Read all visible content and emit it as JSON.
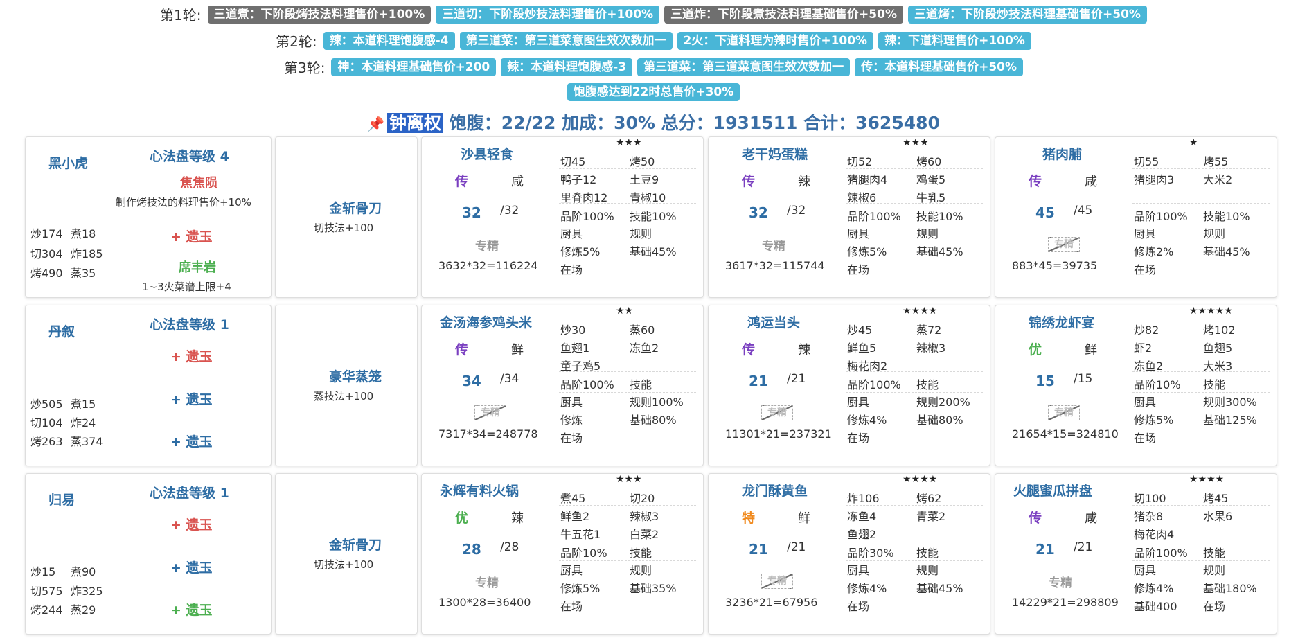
{
  "rounds": [
    {
      "label": "第1轮:",
      "tags": [
        {
          "text": "三道煮：下阶段烤技法料理售价+100%",
          "style": "gray"
        },
        {
          "text": "三道切：下阶段炒技法料理售价+100%",
          "style": "blue"
        },
        {
          "text": "三道炸：下阶段煮技法料理基础售价+50%",
          "style": "gray"
        },
        {
          "text": "三道烤：下阶段炒技法料理基础售价+50%",
          "style": "blue"
        }
      ]
    },
    {
      "label": "第2轮:",
      "tags": [
        {
          "text": "辣：本道料理饱腹感-4",
          "style": "blue"
        },
        {
          "text": "第三道菜：第三道菜意图生效次数加一",
          "style": "blue"
        },
        {
          "text": "2火：下道料理为辣时售价+100%",
          "style": "blue"
        },
        {
          "text": "辣：下道料理售价+100%",
          "style": "blue"
        }
      ]
    },
    {
      "label": "第3轮:",
      "tags": [
        {
          "text": "神：本道料理基础售价+200",
          "style": "blue"
        },
        {
          "text": "辣：本道料理饱腹感-3",
          "style": "blue"
        },
        {
          "text": "第三道菜：第三道菜意图生效次数加一",
          "style": "blue"
        },
        {
          "text": "传：本道料理基础售价+50%",
          "style": "blue"
        }
      ]
    },
    {
      "label": "",
      "tags": [
        {
          "text": "饱腹感达到22时总售价+30%",
          "style": "blue"
        }
      ]
    }
  ],
  "summary": {
    "pin_icon": "pin-icon",
    "chef": "钟离权",
    "text": "饱腹：22/22 加成：30% 总分：1931511 合计：3625480"
  },
  "rows": [
    {
      "chef": {
        "name": "黑小虎",
        "disk": "心法盘等级 4",
        "skill_name": "焦焦陨",
        "skill_desc": "制作烤技法的料理售价+10%",
        "slot1": "+ 遗玉",
        "slot2_name": "席丰岩",
        "slot2_desc": "1~3火菜谱上限+4",
        "stats": [
          [
            "炒174",
            "煮18"
          ],
          [
            "切304",
            "炸185"
          ],
          [
            "烤490",
            "蒸35"
          ]
        ]
      },
      "equip": {
        "name": "金斩骨刀",
        "desc": "切技法+100"
      },
      "dishes": [
        {
          "name": "沙县轻食",
          "stars": "★★★",
          "grade": "传",
          "grade_color": "purple",
          "taste": "咸",
          "qty": "32",
          "max": "/32",
          "skill": "专精",
          "skill_active": true,
          "formula": "3632*32=116224",
          "s1": [
            "切45",
            "烤50"
          ],
          "ing": [
            [
              "鸭子12",
              "土豆9"
            ],
            [
              "里脊肉12",
              "青椒10"
            ]
          ],
          "q": [
            "品阶100%",
            "技能10%"
          ],
          "t": [
            "厨具",
            "规则"
          ],
          "u": [
            "修炼5%",
            "基础45%"
          ],
          "v": [
            "在场",
            ""
          ]
        },
        {
          "name": "老干妈蛋糕",
          "stars": "★★★",
          "grade": "传",
          "grade_color": "purple",
          "taste": "辣",
          "qty": "32",
          "max": "/32",
          "skill": "专精",
          "skill_active": true,
          "formula": "3617*32=115744",
          "s1": [
            "切52",
            "烤60"
          ],
          "ing": [
            [
              "猪腿肉4",
              "鸡蛋5"
            ],
            [
              "辣椒6",
              "牛乳5"
            ]
          ],
          "q": [
            "品阶100%",
            "技能10%"
          ],
          "t": [
            "厨具",
            "规则"
          ],
          "u": [
            "修炼5%",
            "基础45%"
          ],
          "v": [
            "在场",
            ""
          ]
        },
        {
          "name": "猪肉脯",
          "stars": "★",
          "grade": "传",
          "grade_color": "purple",
          "taste": "咸",
          "qty": "45",
          "max": "/45",
          "skill": "专精",
          "skill_active": false,
          "formula": "883*45=39735",
          "s1": [
            "切55",
            "烤55"
          ],
          "ing": [
            [
              "猪腿肉3",
              "大米2"
            ],
            [
              "",
              ""
            ]
          ],
          "q": [
            "品阶100%",
            "技能10%"
          ],
          "t": [
            "厨具",
            "规则"
          ],
          "u": [
            "修炼2%",
            "基础45%"
          ],
          "v": [
            "在场",
            ""
          ]
        }
      ]
    },
    {
      "chef": {
        "name": "丹叙",
        "disk": "心法盘等级 1",
        "skill_name": "",
        "skill_desc": "",
        "slot1": "+ 遗玉",
        "slot2": "+ 遗玉",
        "slot3": "+ 遗玉",
        "stats": [
          [
            "炒505",
            "煮15"
          ],
          [
            "切104",
            "炸24"
          ],
          [
            "烤263",
            "蒸374"
          ]
        ]
      },
      "equip": {
        "name": "豪华蒸笼",
        "desc": "蒸技法+100"
      },
      "dishes": [
        {
          "name": "金汤海参鸡头米",
          "stars": "★★",
          "grade": "传",
          "grade_color": "purple",
          "taste": "鲜",
          "qty": "34",
          "max": "/34",
          "skill": "专精",
          "skill_active": false,
          "formula": "7317*34=248778",
          "s1": [
            "炒30",
            "蒸60"
          ],
          "ing": [
            [
              "鱼翅1",
              "冻鱼2"
            ],
            [
              "童子鸡5",
              ""
            ]
          ],
          "q": [
            "品阶100%",
            "技能"
          ],
          "t": [
            "厨具",
            "规则100%"
          ],
          "u": [
            "修炼",
            "基础80%"
          ],
          "v": [
            "在场",
            ""
          ]
        },
        {
          "name": "鸿运当头",
          "stars": "★★★★",
          "grade": "传",
          "grade_color": "purple",
          "taste": "辣",
          "qty": "21",
          "max": "/21",
          "skill": "专精",
          "skill_active": false,
          "formula": "11301*21=237321",
          "s1": [
            "炒45",
            "蒸72"
          ],
          "ing": [
            [
              "鲜鱼5",
              "辣椒3"
            ],
            [
              "梅花肉2",
              ""
            ]
          ],
          "q": [
            "品阶100%",
            "技能"
          ],
          "t": [
            "厨具",
            "规则200%"
          ],
          "u": [
            "修炼4%",
            "基础80%"
          ],
          "v": [
            "在场",
            ""
          ]
        },
        {
          "name": "锦绣龙虾宴",
          "stars": "★★★★★",
          "grade": "优",
          "grade_color": "green",
          "taste": "鲜",
          "qty": "15",
          "max": "/15",
          "skill": "专精",
          "skill_active": false,
          "formula": "21654*15=324810",
          "s1": [
            "炒82",
            "烤102"
          ],
          "ing": [
            [
              "虾2",
              "鱼翅5"
            ],
            [
              "冻鱼2",
              "大米3"
            ]
          ],
          "q": [
            "品阶10%",
            "技能"
          ],
          "t": [
            "厨具",
            "规则300%"
          ],
          "u": [
            "修炼5%",
            "基础125%"
          ],
          "v": [
            "在场",
            ""
          ]
        }
      ]
    },
    {
      "chef": {
        "name": "归易",
        "disk": "心法盘等级 1",
        "skill_name": "",
        "skill_desc": "",
        "slot1": "+ 遗玉",
        "slot2": "+ 遗玉",
        "slot3": "+ 遗玉",
        "stats": [
          [
            "炒15",
            "煮90"
          ],
          [
            "切575",
            "炸325"
          ],
          [
            "烤244",
            "蒸29"
          ]
        ]
      },
      "equip": {
        "name": "金斩骨刀",
        "desc": "切技法+100"
      },
      "dishes": [
        {
          "name": "永辉有料火锅",
          "stars": "★★★",
          "grade": "优",
          "grade_color": "green",
          "taste": "辣",
          "qty": "28",
          "max": "/28",
          "skill": "专精",
          "skill_active": true,
          "formula": "1300*28=36400",
          "s1": [
            "煮45",
            "切20"
          ],
          "ing": [
            [
              "鲜鱼2",
              "辣椒3"
            ],
            [
              "牛五花1",
              "白菜2"
            ]
          ],
          "q": [
            "品阶10%",
            "技能"
          ],
          "t": [
            "厨具",
            "规则"
          ],
          "u": [
            "修炼5%",
            "基础35%"
          ],
          "v": [
            "在场",
            ""
          ]
        },
        {
          "name": "龙门酥黄鱼",
          "stars": "★★★★",
          "grade": "特",
          "grade_color": "orange",
          "taste": "鲜",
          "qty": "21",
          "max": "/21",
          "skill": "专精",
          "skill_active": false,
          "formula": "3236*21=67956",
          "s1": [
            "炸106",
            "烤62"
          ],
          "ing": [
            [
              "冻鱼4",
              "青菜2"
            ],
            [
              "鱼翅2",
              ""
            ]
          ],
          "q": [
            "品阶30%",
            "技能"
          ],
          "t": [
            "厨具",
            "规则"
          ],
          "u": [
            "修炼4%",
            "基础45%"
          ],
          "v": [
            "在场",
            ""
          ]
        },
        {
          "name": "火腿蜜瓜拼盘",
          "stars": "★★★★",
          "grade": "传",
          "grade_color": "purple",
          "taste": "咸",
          "qty": "21",
          "max": "/21",
          "skill": "专精",
          "skill_active": true,
          "formula": "14229*21=298809",
          "s1": [
            "切100",
            "烤45"
          ],
          "ing": [
            [
              "猪杂8",
              "水果6"
            ],
            [
              "梅花肉4",
              ""
            ]
          ],
          "q": [
            "品阶100%",
            "技能"
          ],
          "t": [
            "厨具",
            "规则"
          ],
          "u": [
            "修炼4%",
            "基础180%"
          ],
          "v": [
            "基础400",
            "在场"
          ]
        }
      ]
    }
  ]
}
